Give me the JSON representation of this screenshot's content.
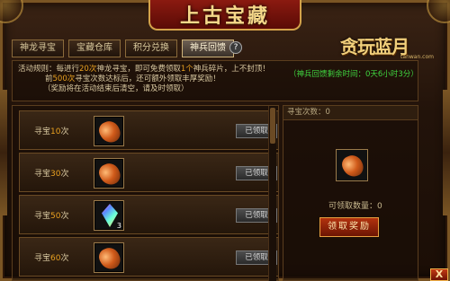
{
  "header": {
    "title": "上古宝藏"
  },
  "tabs": [
    {
      "label": "神龙寻宝",
      "active": false
    },
    {
      "label": "宝藏仓库",
      "active": false
    },
    {
      "label": "积分兑换",
      "active": false
    },
    {
      "label": "神兵回馈",
      "active": true
    }
  ],
  "help_label": "?",
  "logo": {
    "main": "贪玩蓝月",
    "sub": "tanwan.com"
  },
  "rules": {
    "line1_a": "活动规则：每进行",
    "line1_num1": "20次",
    "line1_b": "神龙寻宝，即可免费领取",
    "line1_num2": "1个",
    "line1_c": "神兵碎片，上不封顶！",
    "line2_a": "前",
    "line2_num": "500次",
    "line2_b": "寻宝次数达标后，还可额外领取丰厚奖励！",
    "line3": "（奖励将在活动结束后清空，请及时领取）"
  },
  "timer": "（神兵回馈剩余时间：0天6小时3分）",
  "rows": [
    {
      "label_prefix": "寻宝",
      "count": "10",
      "label_suffix": "次",
      "item": "ore-icon",
      "quantity": "",
      "button": "已领取"
    },
    {
      "label_prefix": "寻宝",
      "count": "30",
      "label_suffix": "次",
      "item": "ore-icon",
      "quantity": "",
      "button": "已领取"
    },
    {
      "label_prefix": "寻宝",
      "count": "50",
      "label_suffix": "次",
      "item": "crystal-icon",
      "quantity": "3",
      "button": "已领取"
    },
    {
      "label_prefix": "寻宝",
      "count": "60",
      "label_suffix": "次",
      "item": "ore-icon",
      "quantity": "",
      "button": "已领取"
    }
  ],
  "right": {
    "header": "寻宝次数：0",
    "available": "可领取数量：0",
    "claim_button": "领取奖励"
  },
  "close_label": "X",
  "colors": {
    "accent": "#e8a020",
    "timer": "#3fd43f",
    "claim": "#b2320e"
  }
}
